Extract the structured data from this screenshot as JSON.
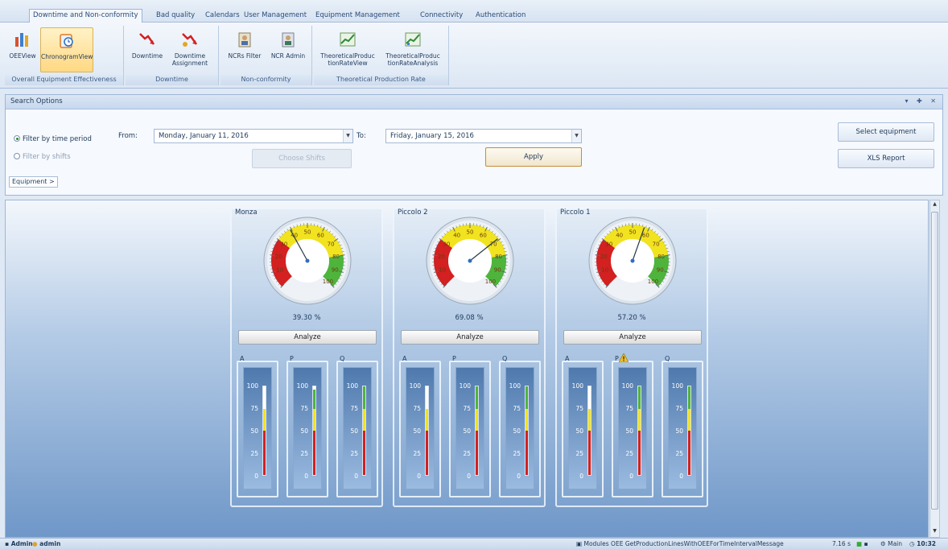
{
  "ribbon": {
    "tabs": [
      "Downtime and Non-conformity",
      "Bad quality",
      "Calendars",
      "User Management",
      "Equipment Management",
      "Connectivity",
      "Authentication"
    ],
    "groups": [
      {
        "label": "Overall Equipment Effectiveness",
        "buttons": [
          "OEEView",
          "ChronogramView"
        ]
      },
      {
        "label": "Downtime",
        "buttons": [
          "Downtime",
          "Downtime Assignment"
        ]
      },
      {
        "label": "Non-conformity",
        "buttons": [
          "NCRs Filter",
          "NCR Admin"
        ]
      },
      {
        "label": "Theoretical Production Rate",
        "buttons": [
          "TheoreticalProduc tionRateView",
          "TheoreticalProduc tionRateAnalysis"
        ]
      }
    ]
  },
  "search": {
    "title": "Search Options",
    "panel_controls": "▾ ✚ ✕",
    "filter_time": "Filter by time period",
    "filter_shifts": "Filter by shifts",
    "from_label": "From:",
    "from_value": "Monday, January 11, 2016",
    "to_label": "To:",
    "to_value": "Friday, January 15, 2016",
    "choose_shifts": "Choose Shifts",
    "apply": "Apply",
    "select_equipment": "Select equipment",
    "xls_report": "XLS Report",
    "breadcrumb": "Equipment >"
  },
  "meter_scale": [
    "100",
    "75",
    "50",
    "25",
    "0"
  ],
  "analyze_label": "Analyze",
  "colors": {
    "red": "#d32020",
    "yellow": "#f1e31f",
    "green": "#4fb43c",
    "white": "#ffffff"
  },
  "cards": [
    {
      "name": "Monza",
      "percent": "39.30 %",
      "gauge_value": 39.3,
      "meters": [
        {
          "label": "A",
          "value": 100
        },
        {
          "label": "P",
          "value": 96
        },
        {
          "label": "Q",
          "value": 100
        }
      ]
    },
    {
      "name": "Piccolo 2",
      "percent": "69.08 %",
      "gauge_value": 69.08,
      "meters": [
        {
          "label": "A",
          "value": 100
        },
        {
          "label": "P",
          "value": 100
        },
        {
          "label": "Q",
          "value": 100
        }
      ]
    },
    {
      "name": "Piccolo 1",
      "percent": "57.20 %",
      "gauge_value": 57.2,
      "meters": [
        {
          "label": "A",
          "value": 100
        },
        {
          "label": "P",
          "value": 100,
          "warning": true
        },
        {
          "label": "Q",
          "value": 100
        }
      ]
    }
  ],
  "status": {
    "user1": "Admin",
    "user2": "admin",
    "message": "Modules OEE GetProductionLinesWithOEEForTimeIntervalMessage",
    "elapsed": "7.16 s",
    "server": "Main",
    "time": "10:32"
  }
}
